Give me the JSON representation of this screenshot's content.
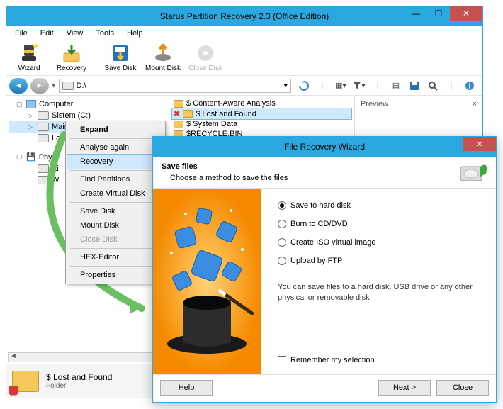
{
  "main": {
    "title": "Starus Partition Recovery 2.3 (Office Edition)",
    "menu": {
      "file": "File",
      "edit": "Edit",
      "view": "View",
      "tools": "Tools",
      "help": "Help"
    },
    "toolbar": {
      "wizard": "Wizard",
      "recovery": "Recovery",
      "save_disk": "Save Disk",
      "mount_disk": "Mount Disk",
      "close_disk": "Close Disk"
    },
    "address": "D:\\",
    "tree": {
      "computer": "Computer",
      "sistem": "Sistem (C:)",
      "main": "Main (D:)",
      "lo": "Lo",
      "physi": "Physi",
      "ki": "Ki",
      "w": "W"
    },
    "files": {
      "content_aware": "$ Content-Aware Analysis",
      "lost_found": "$ Lost and Found",
      "system_data": "$ System Data",
      "recycle": "$RECYCLE.BIN"
    },
    "preview": {
      "label": "Preview",
      "close": "×"
    },
    "status": {
      "name": "$ Lost and Found",
      "type": "Folder"
    }
  },
  "ctx": {
    "expand": "Expand",
    "analyse": "Analyse again",
    "recovery": "Recovery",
    "find": "Find Partitions",
    "vdisk": "Create Virtual Disk",
    "save": "Save Disk",
    "mount": "Mount Disk",
    "close": "Close Disk",
    "hex": "HEX-Editor",
    "props": "Properties"
  },
  "wizard": {
    "title": "File Recovery Wizard",
    "h1": "Save files",
    "h2": "Choose a method to save the files",
    "opt_hd": "Save to hard disk",
    "opt_cd": "Burn to CD/DVD",
    "opt_iso": "Create ISO virtual image",
    "opt_ftp": "Upload by FTP",
    "hint": "You can save files to a hard disk, USB drive or any other physical or removable disk",
    "remember": "Remember my selection",
    "help": "Help",
    "next": "Next >",
    "close": "Close"
  }
}
